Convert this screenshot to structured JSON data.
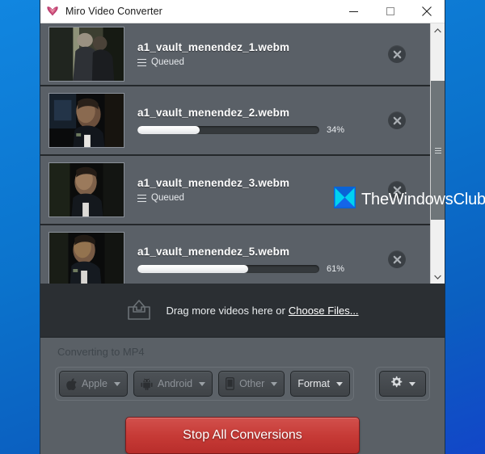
{
  "window": {
    "title": "Miro Video Converter",
    "icon": "miro-butterfly-icon",
    "minimize_label": "Minimize",
    "maximize_label": "Maximize",
    "close_label": "Close"
  },
  "file_list": {
    "items": [
      {
        "filename": "a1_vault_menendez_1.webm",
        "status": "Queued",
        "state": "queued",
        "progress": null,
        "progress_label": "",
        "remove_label": "Remove"
      },
      {
        "filename": "a1_vault_menendez_2.webm",
        "status": "",
        "state": "converting",
        "progress": 34,
        "progress_label": "34%",
        "remove_label": "Remove"
      },
      {
        "filename": "a1_vault_menendez_3.webm",
        "status": "Queued",
        "state": "queued",
        "progress": null,
        "progress_label": "",
        "remove_label": "Remove"
      },
      {
        "filename": "a1_vault_menendez_5.webm",
        "status": "",
        "state": "converting",
        "progress": 61,
        "progress_label": "61%",
        "remove_label": "Remove"
      }
    ]
  },
  "scrollbar": {
    "up_label": "Scroll up",
    "down_label": "Scroll down",
    "thumb_label": "Scroll thumb"
  },
  "dropzone": {
    "icon": "inbox-tray-icon",
    "text": "Drag more videos here or",
    "link": "Choose Files..."
  },
  "footer": {
    "converting_label": "Converting to MP4",
    "buttons": [
      {
        "label": "Apple",
        "icon": "apple-icon",
        "enabled": false
      },
      {
        "label": "Android",
        "icon": "android-icon",
        "enabled": false
      },
      {
        "label": "Other",
        "icon": "phone-icon",
        "enabled": false
      },
      {
        "label": "Format",
        "icon": "",
        "enabled": true
      }
    ],
    "settings": {
      "icon": "gear-icon",
      "label": "Settings"
    },
    "stop_button": "Stop All Conversions"
  },
  "watermark": {
    "text": "TheWindowsClub",
    "logo": "bowtie-logo",
    "color_cyan": "#00d2f0",
    "color_blue": "#0a63d6"
  },
  "colors": {
    "accent_red": "#c63a36",
    "row_bg": "#5a6067",
    "panel_bg": "#2b2f33",
    "footer_bg": "#5a6066",
    "desktop_blue": "#0b73cc"
  }
}
